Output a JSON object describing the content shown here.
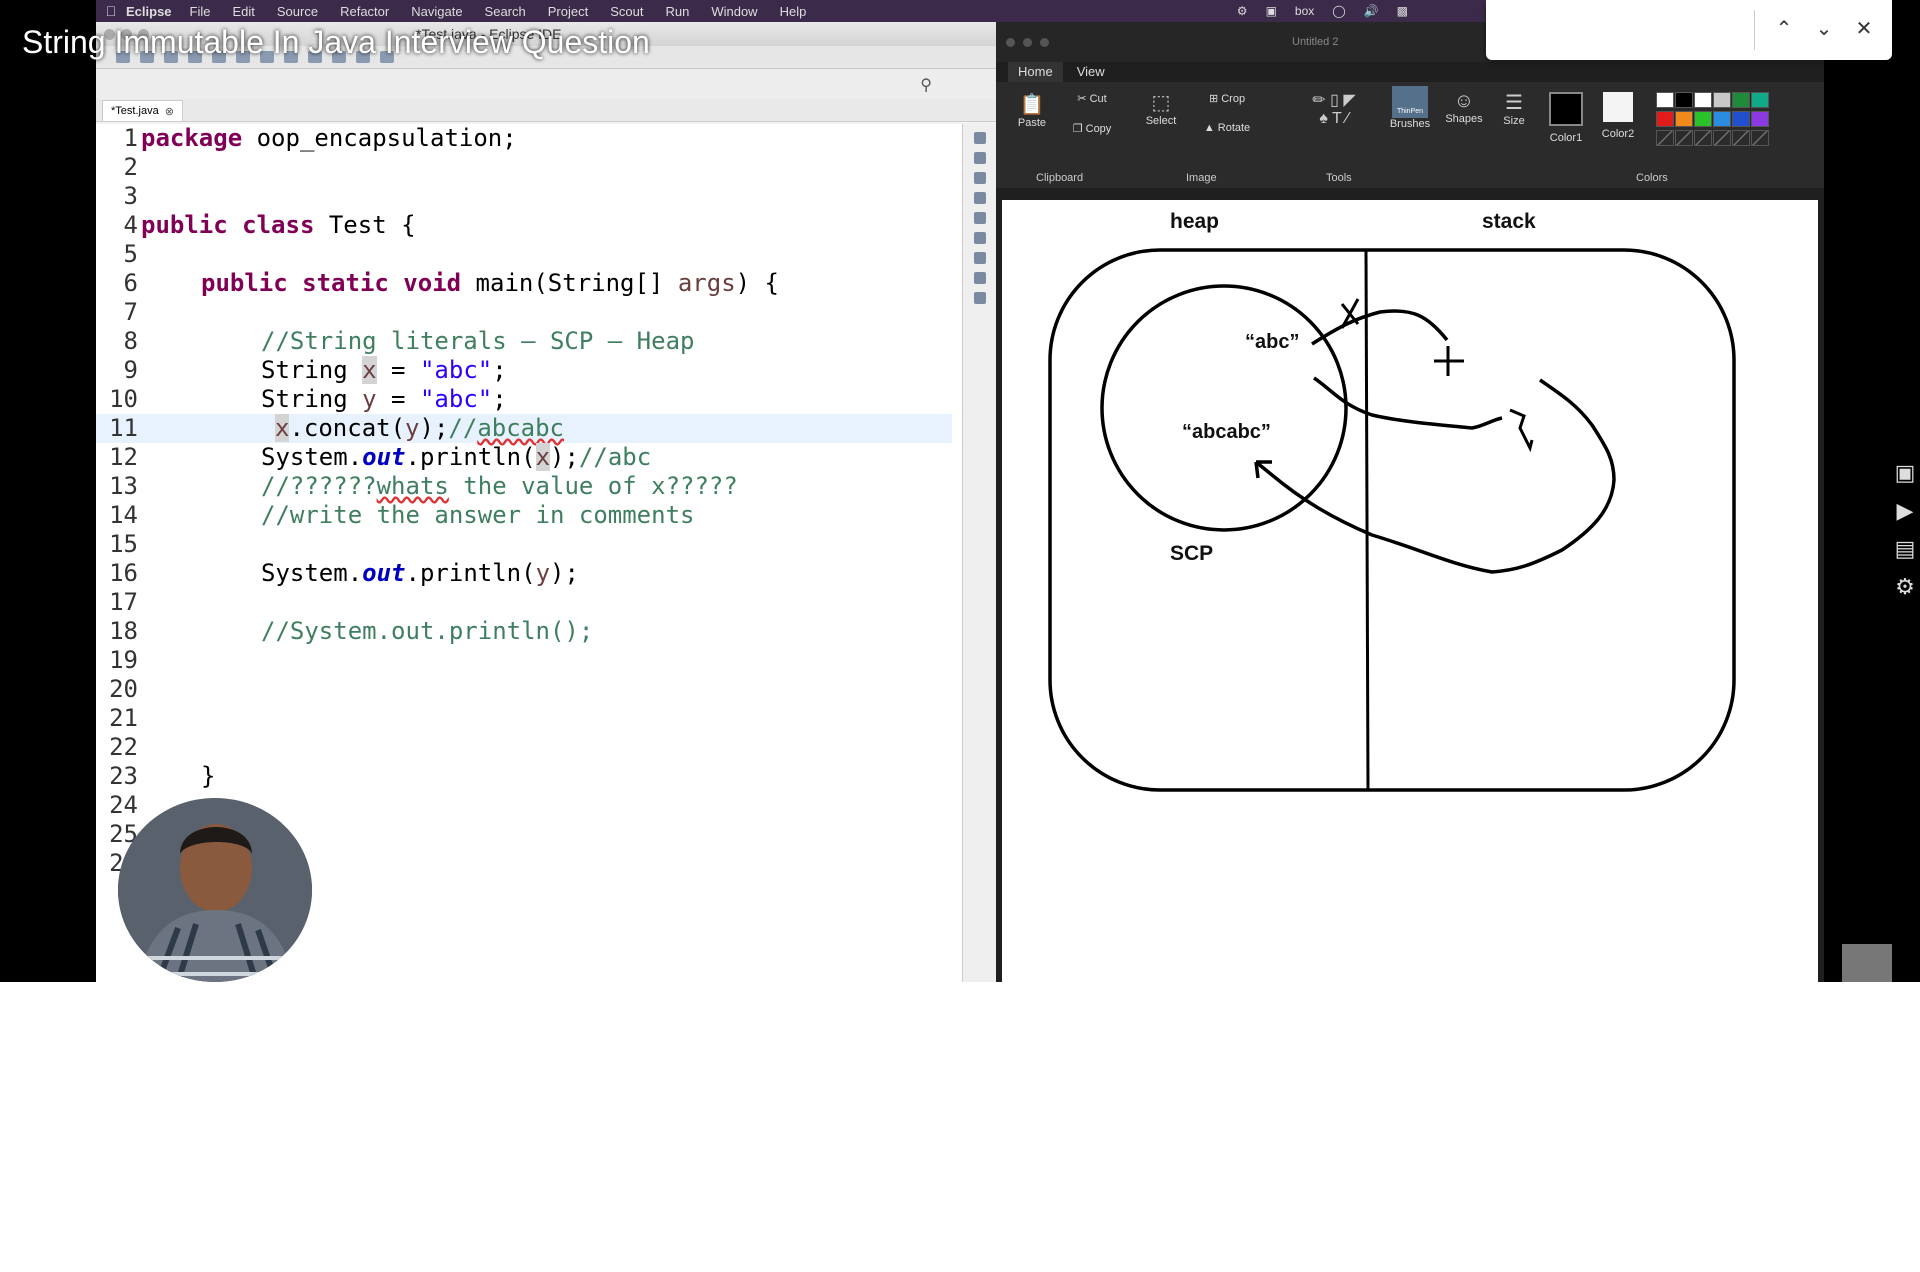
{
  "video": {
    "title": "String Immutable In Java Interview Question"
  },
  "menubar": {
    "app": "Eclipse",
    "items": [
      "File",
      "Edit",
      "Source",
      "Refactor",
      "Navigate",
      "Search",
      "Project",
      "Scout",
      "Run",
      "Window",
      "Help"
    ],
    "status_box": "box"
  },
  "eclipse": {
    "window_title": "*Test.java - Eclipse IDE",
    "tab_label": "*Test.java",
    "lines": [
      {
        "n": "1"
      },
      {
        "n": "2"
      },
      {
        "n": "3"
      },
      {
        "n": "4"
      },
      {
        "n": "5"
      },
      {
        "n": "6"
      },
      {
        "n": "7"
      },
      {
        "n": "8"
      },
      {
        "n": "9"
      },
      {
        "n": "10"
      },
      {
        "n": "11"
      },
      {
        "n": "12"
      },
      {
        "n": "13"
      },
      {
        "n": "14"
      },
      {
        "n": "15"
      },
      {
        "n": "16"
      },
      {
        "n": "17"
      },
      {
        "n": "18"
      },
      {
        "n": "19"
      },
      {
        "n": "20"
      },
      {
        "n": "21"
      },
      {
        "n": "22"
      },
      {
        "n": "23"
      },
      {
        "n": "24"
      },
      {
        "n": "25"
      },
      {
        "n": "26"
      }
    ],
    "code": {
      "l1_kw": "package",
      "l1_rest": " oop_encapsulation;",
      "l4_kw": "public class",
      "l4_rest": " Test {",
      "l6_kw": "public static void",
      "l6_rest": " main(String[] ",
      "l6_var": "args",
      "l6_end": ") {",
      "l8": "//String literals – SCP – Heap",
      "l9_a": "String ",
      "l9_var": "x",
      "l9_b": " = ",
      "l9_str": "\"abc\"",
      "l9_c": ";",
      "l10_a": "String ",
      "l10_var": "y",
      "l10_b": " = ",
      "l10_str": "\"abc\"",
      "l10_c": ";",
      "l11_var": "x",
      "l11_a": ".concat(",
      "l11_var2": "y",
      "l11_b": ");",
      "l11_cm1": "//",
      "l11_cm2": "abcabc",
      "l12_a": "System.",
      "l12_fld": "out",
      "l12_b": ".println(",
      "l12_var": "x",
      "l12_c": ");",
      "l12_cm": "//abc",
      "l13_a": "//??????",
      "l13_b": "whats",
      "l13_c": " the value of x?????",
      "l14": "//write the answer in comments",
      "l16_a": "System.",
      "l16_fld": "out",
      "l16_b": ".println(",
      "l16_var": "y",
      "l16_c": ");",
      "l18": "//System.out.println();",
      "l23": "}"
    }
  },
  "paint": {
    "document": "Untitled 2",
    "tabs": [
      "Home",
      "View"
    ],
    "buttons": {
      "paste": "Paste",
      "cut": "Cut",
      "copy": "Copy",
      "select": "Select",
      "crop": "Crop",
      "rotate": "Rotate",
      "brushes": "Brushes",
      "brush_name": "ThinPen",
      "shapes": "Shapes",
      "size": "Size",
      "color1": "Color1",
      "color2": "Color2"
    },
    "groups": [
      "Clipboard",
      "Image",
      "Tools",
      "Colors"
    ],
    "palette": [
      "#ffffff",
      "#000000",
      "#ffffff",
      "#c8c8c8",
      "#1e8a3a",
      "#11aa88",
      "#e21b1b",
      "#f08a1a",
      "#29c229",
      "#2a8de0",
      "#2050d0",
      "#8a3ae0"
    ],
    "drawing": {
      "heap_label": "heap",
      "stack_label": "stack",
      "abc_label": "“abc”",
      "abcabc_label": "“abcabc”",
      "scp_label": "SCP"
    }
  },
  "find": {
    "up_icon": "chevron-up",
    "down_icon": "chevron-down",
    "close_icon": "close"
  }
}
